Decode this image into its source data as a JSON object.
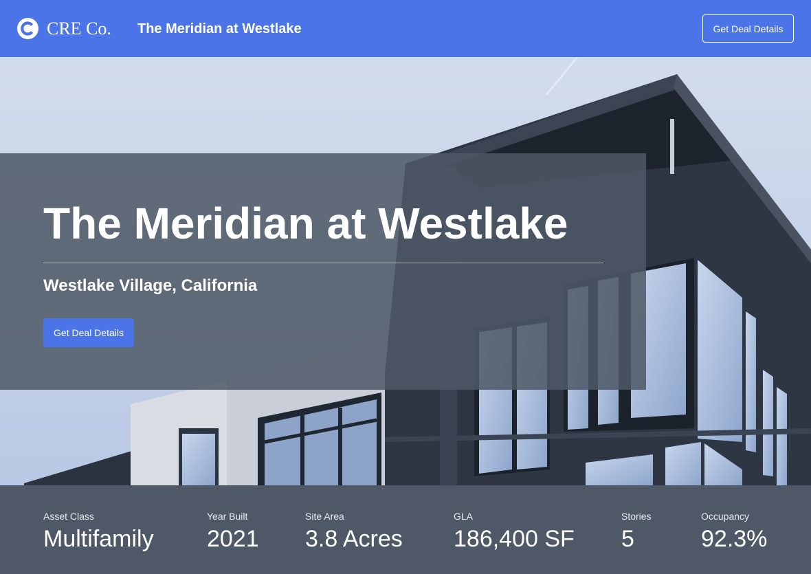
{
  "header": {
    "brand": "CRE Co.",
    "title": "The Meridian at Westlake",
    "cta_label": "Get Deal Details"
  },
  "hero": {
    "title": "The Meridian at Westlake",
    "location": "Westlake Village, California",
    "cta_label": "Get Deal Details"
  },
  "stats": [
    {
      "label": "Asset Class",
      "value": "Multifamily"
    },
    {
      "label": "Year Built",
      "value": "2021"
    },
    {
      "label": "Site Area",
      "value": "3.8 Acres"
    },
    {
      "label": "GLA",
      "value": "186,400 SF"
    },
    {
      "label": "Stories",
      "value": "5"
    },
    {
      "label": "Occupancy",
      "value": "92.3%"
    }
  ],
  "colors": {
    "brand_blue": "#4a74e8",
    "overlay": "#4e5866",
    "sky": "#c9d6ec"
  }
}
